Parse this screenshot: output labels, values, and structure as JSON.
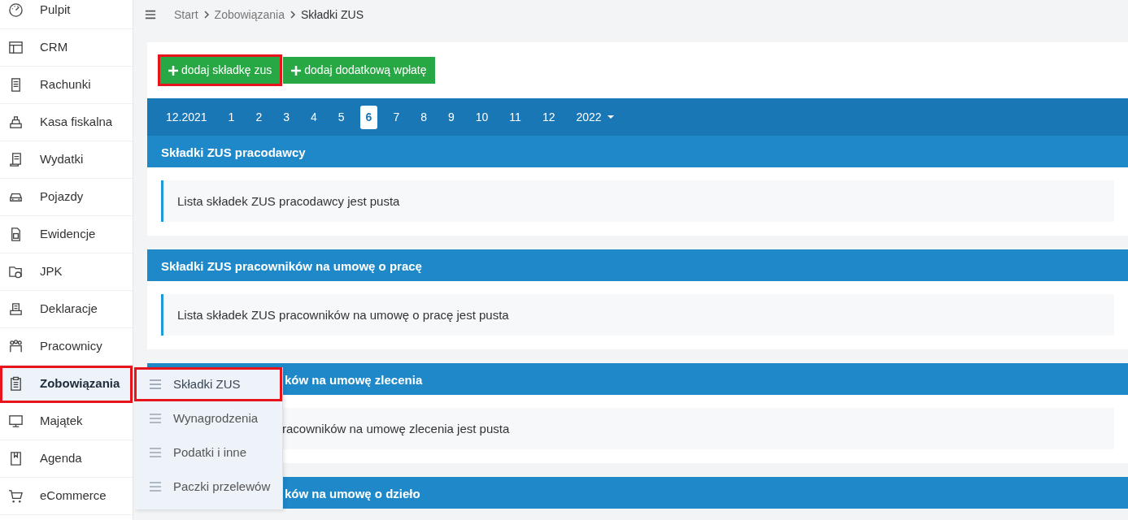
{
  "sidebar": {
    "items": [
      {
        "label": "Pulpit",
        "selected": false,
        "highlighted": false
      },
      {
        "label": "CRM",
        "selected": false,
        "highlighted": false
      },
      {
        "label": "Rachunki",
        "selected": false,
        "highlighted": false
      },
      {
        "label": "Kasa fiskalna",
        "selected": false,
        "highlighted": false
      },
      {
        "label": "Wydatki",
        "selected": false,
        "highlighted": false
      },
      {
        "label": "Pojazdy",
        "selected": false,
        "highlighted": false
      },
      {
        "label": "Ewidencje",
        "selected": false,
        "highlighted": false
      },
      {
        "label": "JPK",
        "selected": false,
        "highlighted": false
      },
      {
        "label": "Deklaracje",
        "selected": false,
        "highlighted": false
      },
      {
        "label": "Pracownicy",
        "selected": false,
        "highlighted": false
      },
      {
        "label": "Zobowiązania",
        "selected": true,
        "highlighted": true
      },
      {
        "label": "Majątek",
        "selected": false,
        "highlighted": false
      },
      {
        "label": "Agenda",
        "selected": false,
        "highlighted": false
      },
      {
        "label": "eCommerce",
        "selected": false,
        "highlighted": false
      }
    ]
  },
  "submenu": {
    "items": [
      {
        "label": "Składki ZUS",
        "selected": true,
        "highlighted": true
      },
      {
        "label": "Wynagrodzenia",
        "selected": false,
        "highlighted": false
      },
      {
        "label": "Podatki i inne",
        "selected": false,
        "highlighted": false
      },
      {
        "label": "Paczki przelewów",
        "selected": false,
        "highlighted": false
      }
    ]
  },
  "breadcrumb": [
    "Start",
    "Zobowiązania",
    "Składki ZUS"
  ],
  "buttons": [
    {
      "label": "dodaj składkę zus",
      "highlighted": true
    },
    {
      "label": "dodaj dodatkową wpłatę",
      "highlighted": false
    }
  ],
  "months": {
    "items": [
      {
        "label": "12.2021",
        "selected": false
      },
      {
        "label": "1",
        "selected": false
      },
      {
        "label": "2",
        "selected": false
      },
      {
        "label": "3",
        "selected": false
      },
      {
        "label": "4",
        "selected": false
      },
      {
        "label": "5",
        "selected": false
      },
      {
        "label": "6",
        "selected": true
      },
      {
        "label": "7",
        "selected": false
      },
      {
        "label": "8",
        "selected": false
      },
      {
        "label": "9",
        "selected": false
      },
      {
        "label": "10",
        "selected": false
      },
      {
        "label": "11",
        "selected": false
      },
      {
        "label": "12",
        "selected": false
      }
    ],
    "year": "2022"
  },
  "sections": [
    {
      "title": "Składki ZUS pracodawcy",
      "empty_text": "Lista składek ZUS pracodawcy jest pusta",
      "covered": false
    },
    {
      "title": "Składki ZUS pracowników na umowę o pracę",
      "empty_text": "Lista składek ZUS pracowników na umowę o pracę jest pusta",
      "covered": false
    },
    {
      "title": "ków na umowę zlecenia",
      "empty_text": "racowników na umowę zlecenia jest pusta",
      "covered": true
    },
    {
      "title": "ków na umowę o dzieło",
      "covered": true
    }
  ]
}
